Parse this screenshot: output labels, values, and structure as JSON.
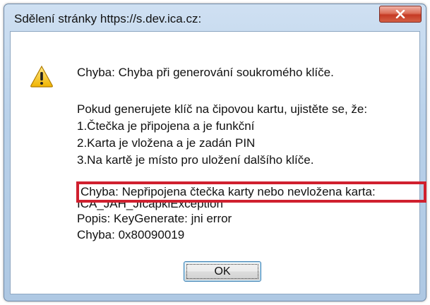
{
  "dialog": {
    "title": "Sdělení stránky https://s.dev.ica.cz:",
    "close_icon": "close-icon",
    "warning_icon": "warning-icon",
    "heading": "Chyba: Chyba při generování soukromého klíče.",
    "instructions": [
      "Pokud generujete klíč na čipovou kartu, ujistěte se, že:",
      "1.Čtečka je připojena a je funkční",
      "2.Karta je vložena a je zadán PIN",
      "3.Na kartě je místo pro uložení dalšího klíče."
    ],
    "highlighted_error": "Chyba: Nepřipojena čtečka karty nebo nevložena karta:",
    "exception": "ICA_JAH_JIcapkiException",
    "description": "Popis: KeyGenerate: jni error",
    "error_code": "Chyba: 0x80090019",
    "ok_label": "OK",
    "highlight_color": "#d0202f"
  }
}
